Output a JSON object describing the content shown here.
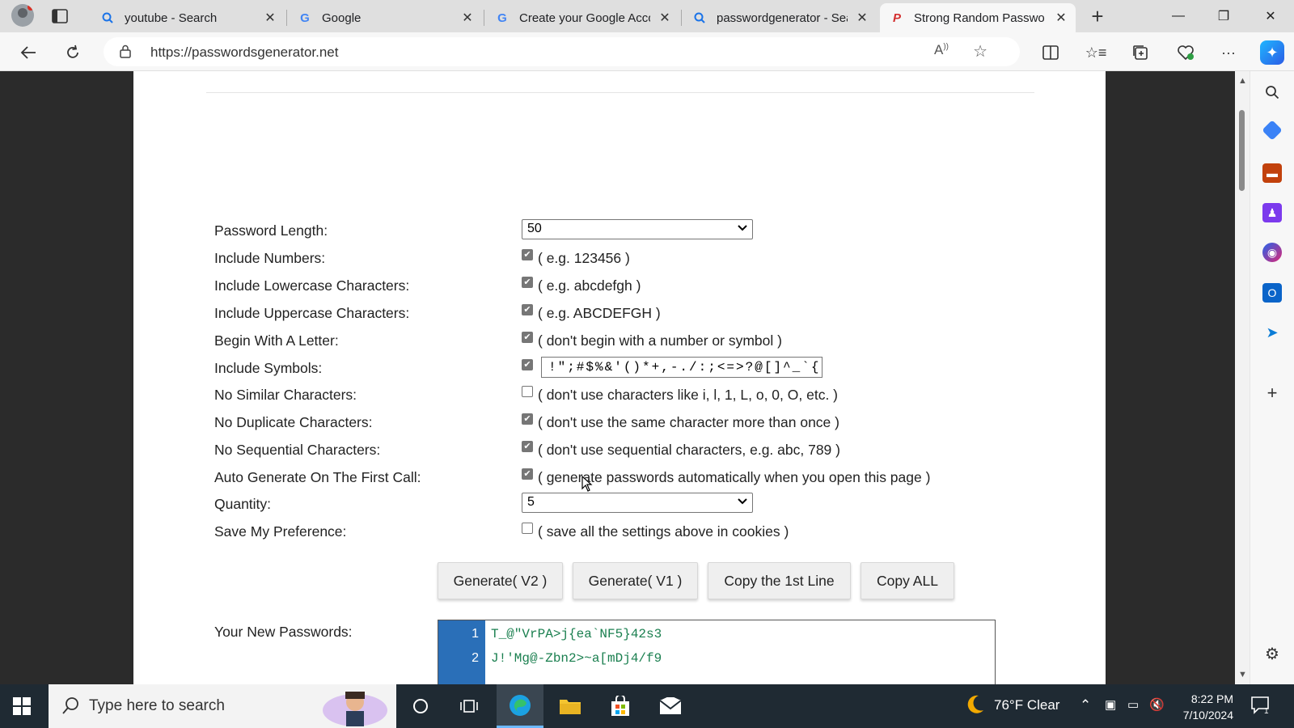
{
  "browser": {
    "tabs": [
      {
        "title": "youtube - Search",
        "favicon": "search-icon"
      },
      {
        "title": "Google",
        "favicon": "google-icon"
      },
      {
        "title": "Create your Google Acco",
        "favicon": "google-icon"
      },
      {
        "title": "passwordgenerator - Sea",
        "favicon": "search-icon"
      },
      {
        "title": "Strong Random Passwor",
        "favicon": "passwordsgenerator-icon"
      }
    ],
    "url": "https://passwordsgenerator.net"
  },
  "form": {
    "length_label": "Password Length:",
    "length_value": "50",
    "numbers_label": "Include Numbers:",
    "numbers_desc": "( e.g. 123456 )",
    "numbers_checked": true,
    "lower_label": "Include Lowercase Characters:",
    "lower_desc": "( e.g. abcdefgh )",
    "lower_checked": true,
    "upper_label": "Include Uppercase Characters:",
    "upper_desc": "( e.g. ABCDEFGH )",
    "upper_checked": true,
    "begin_label": "Begin With A Letter:",
    "begin_desc": "( don't begin with a number or symbol )",
    "begin_checked": true,
    "symbols_label": "Include Symbols:",
    "symbols_value": "!\";#$%&'()*+,-./:;<=>?@[]^_`{|}~",
    "symbols_checked": true,
    "similar_label": "No Similar Characters:",
    "similar_desc": "( don't use characters like i, l, 1, L, o, 0, O, etc. )",
    "similar_checked": false,
    "duplicate_label": "No Duplicate Characters:",
    "duplicate_desc": "( don't use the same character more than once )",
    "duplicate_checked": true,
    "sequential_label": "No Sequential Characters:",
    "sequential_desc": "( don't use sequential characters, e.g. abc, 789 )",
    "sequential_checked": true,
    "auto_label": "Auto Generate On The First Call:",
    "auto_desc": "( generate passwords automatically when you open this page )",
    "auto_checked": true,
    "quantity_label": "Quantity:",
    "quantity_value": "5",
    "save_label": "Save My Preference:",
    "save_desc": "( save all the settings above in cookies )",
    "save_checked": false
  },
  "buttons": {
    "gen_v2": "Generate( V2 )",
    "gen_v1": "Generate( V1 )",
    "copy_first": "Copy the 1st Line",
    "copy_all": "Copy ALL"
  },
  "passwords": {
    "label": "Your New Passwords:",
    "lines": [
      {
        "num": "1",
        "text": "T_@\"VrPA>j{ea`NF5}42s3"
      },
      {
        "num": "2",
        "text": "J!'Mg@-Zbn2>~a[mDj4/f9"
      }
    ]
  },
  "taskbar": {
    "search_placeholder": "Type here to search",
    "weather": "76°F  Clear",
    "time": "8:22 PM",
    "date": "7/10/2024",
    "notification_count": "1"
  },
  "colors": {
    "gutter": "#2a6fb8",
    "password_text": "#1a7f4f",
    "taskbar": "#1f2a33"
  }
}
